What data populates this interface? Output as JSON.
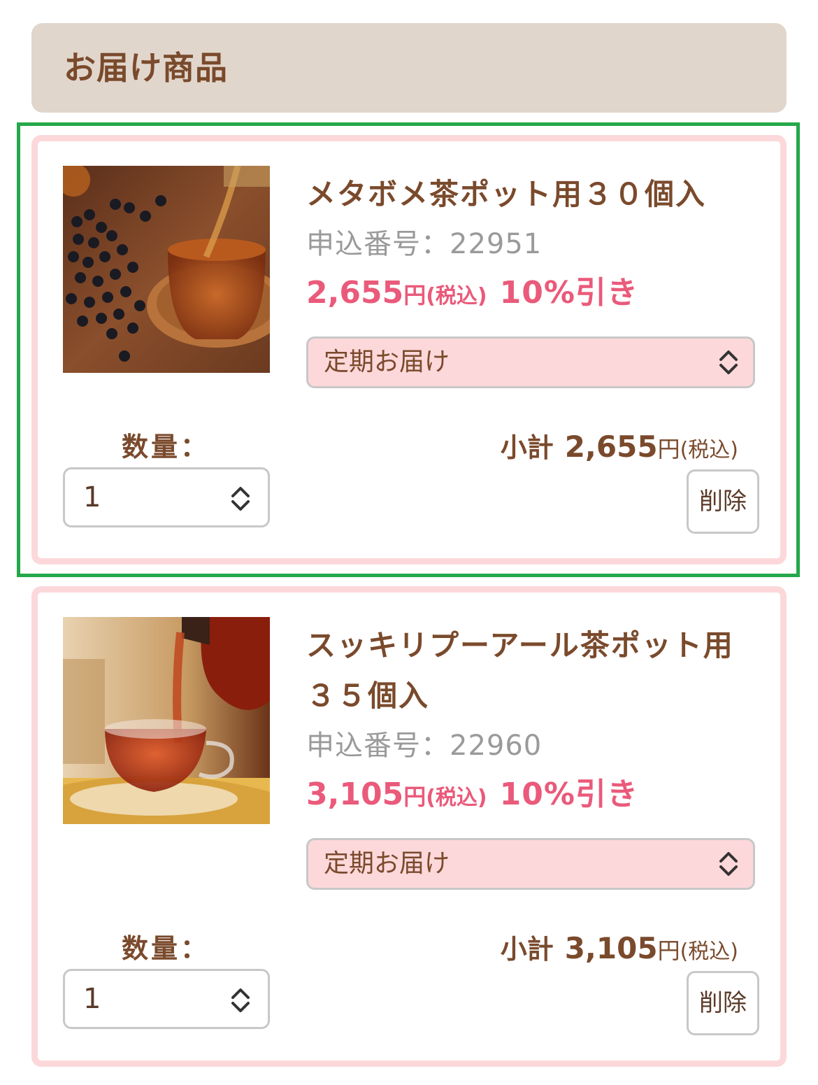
{
  "section": {
    "title": "お届け商品"
  },
  "items": [
    {
      "name": "メタボメ茶ポット用３０個入",
      "order_no": "申込番号：22951",
      "price": "2,655",
      "yen": "円",
      "tax": "(税込)",
      "discount": "10%引き",
      "delivery": "定期お届け",
      "qty_label": "数量：",
      "qty": "1",
      "subtotal_label": "小計",
      "subtotal": "2,655",
      "subtotal_yen": "円",
      "subtotal_tax": "(税込)",
      "delete": "削除",
      "image_icon": "tea-black-beans-photo"
    },
    {
      "name": "スッキリプーアール茶ポット用３５個入",
      "order_no": "申込番号：22960",
      "price": "3,105",
      "yen": "円",
      "tax": "(税込)",
      "discount": "10%引き",
      "delivery": "定期お届け",
      "qty_label": "数量：",
      "qty": "1",
      "subtotal_label": "小計",
      "subtotal": "3,105",
      "subtotal_yen": "円",
      "subtotal_tax": "(税込)",
      "delete": "削除",
      "image_icon": "tea-pouring-cup-photo"
    }
  ],
  "colors": {
    "header_bg": "#e1d6cc",
    "brand_brown": "#7a4a2c",
    "price_pink": "#ea5a7a",
    "card_border": "#fcd8da",
    "select_bg": "#fdd8da",
    "highlight": "#24a84a"
  }
}
